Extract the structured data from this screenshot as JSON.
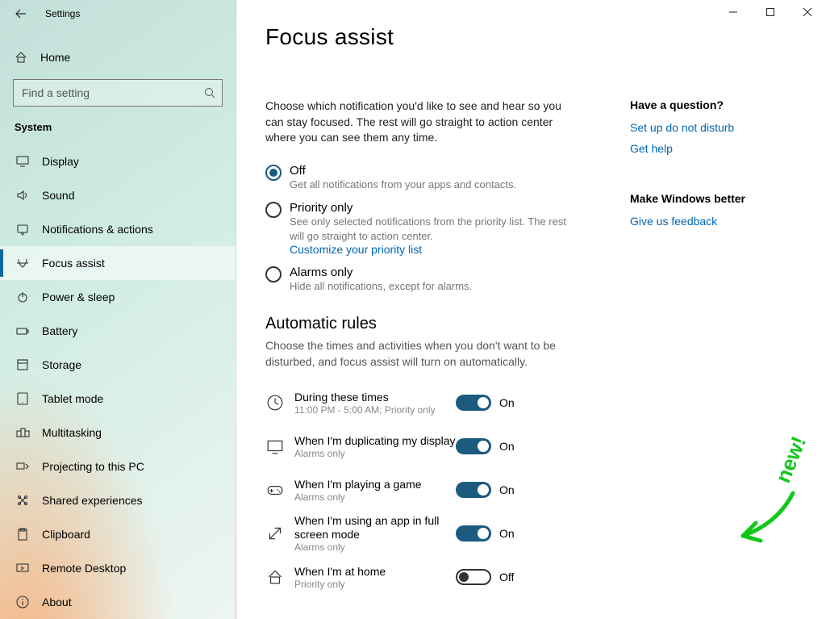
{
  "window": {
    "title": "Settings"
  },
  "sidebar": {
    "home": "Home",
    "searchPlaceholder": "Find a setting",
    "section": "System",
    "items": [
      {
        "label": "Display",
        "icon": "display-icon",
        "selected": false
      },
      {
        "label": "Sound",
        "icon": "sound-icon",
        "selected": false
      },
      {
        "label": "Notifications & actions",
        "icon": "notifications-icon",
        "selected": false
      },
      {
        "label": "Focus assist",
        "icon": "focus-assist-icon",
        "selected": true
      },
      {
        "label": "Power & sleep",
        "icon": "power-icon",
        "selected": false
      },
      {
        "label": "Battery",
        "icon": "battery-icon",
        "selected": false
      },
      {
        "label": "Storage",
        "icon": "storage-icon",
        "selected": false
      },
      {
        "label": "Tablet mode",
        "icon": "tablet-icon",
        "selected": false
      },
      {
        "label": "Multitasking",
        "icon": "multitasking-icon",
        "selected": false
      },
      {
        "label": "Projecting to this PC",
        "icon": "projecting-icon",
        "selected": false
      },
      {
        "label": "Shared experiences",
        "icon": "shared-icon",
        "selected": false
      },
      {
        "label": "Clipboard",
        "icon": "clipboard-icon",
        "selected": false
      },
      {
        "label": "Remote Desktop",
        "icon": "remote-icon",
        "selected": false
      },
      {
        "label": "About",
        "icon": "about-icon",
        "selected": false
      }
    ]
  },
  "page": {
    "title": "Focus assist",
    "description": "Choose which notification you'd like to see and hear so you can stay focused. The rest will go straight to action center where you can see them any time.",
    "options": [
      {
        "label": "Off",
        "sub": "Get all notifications from your apps and contacts.",
        "checked": true
      },
      {
        "label": "Priority only",
        "sub": "See only selected notifications from the priority list. The rest will go straight to action center.",
        "link": "Customize your priority list",
        "checked": false
      },
      {
        "label": "Alarms only",
        "sub": "Hide all notifications, except for alarms.",
        "checked": false
      }
    ],
    "rulesHeading": "Automatic rules",
    "rulesDesc": "Choose the times and activities when you don't want to be disturbed, and focus assist will turn on automatically.",
    "rules": [
      {
        "title": "During these times",
        "sub": "11:00 PM - 5:00 AM; Priority only",
        "icon": "clock-icon",
        "on": true
      },
      {
        "title": "When I'm duplicating my display",
        "sub": "Alarms only",
        "icon": "monitor-icon",
        "on": true
      },
      {
        "title": "When I'm playing a game",
        "sub": "Alarms only",
        "icon": "gamepad-icon",
        "on": true
      },
      {
        "title": "When I'm using an app in full screen mode",
        "sub": "Alarms only",
        "icon": "fullscreen-icon",
        "on": true
      },
      {
        "title": "When I'm at home",
        "sub": "Priority only",
        "icon": "home-icon",
        "on": false
      }
    ],
    "toggleOn": "On",
    "toggleOff": "Off"
  },
  "side": {
    "questionHeading": "Have a question?",
    "links1": [
      "Set up do not disturb",
      "Get help"
    ],
    "betterHeading": "Make Windows better",
    "links2": [
      "Give us feedback"
    ]
  },
  "annotation": {
    "text": "new!"
  }
}
